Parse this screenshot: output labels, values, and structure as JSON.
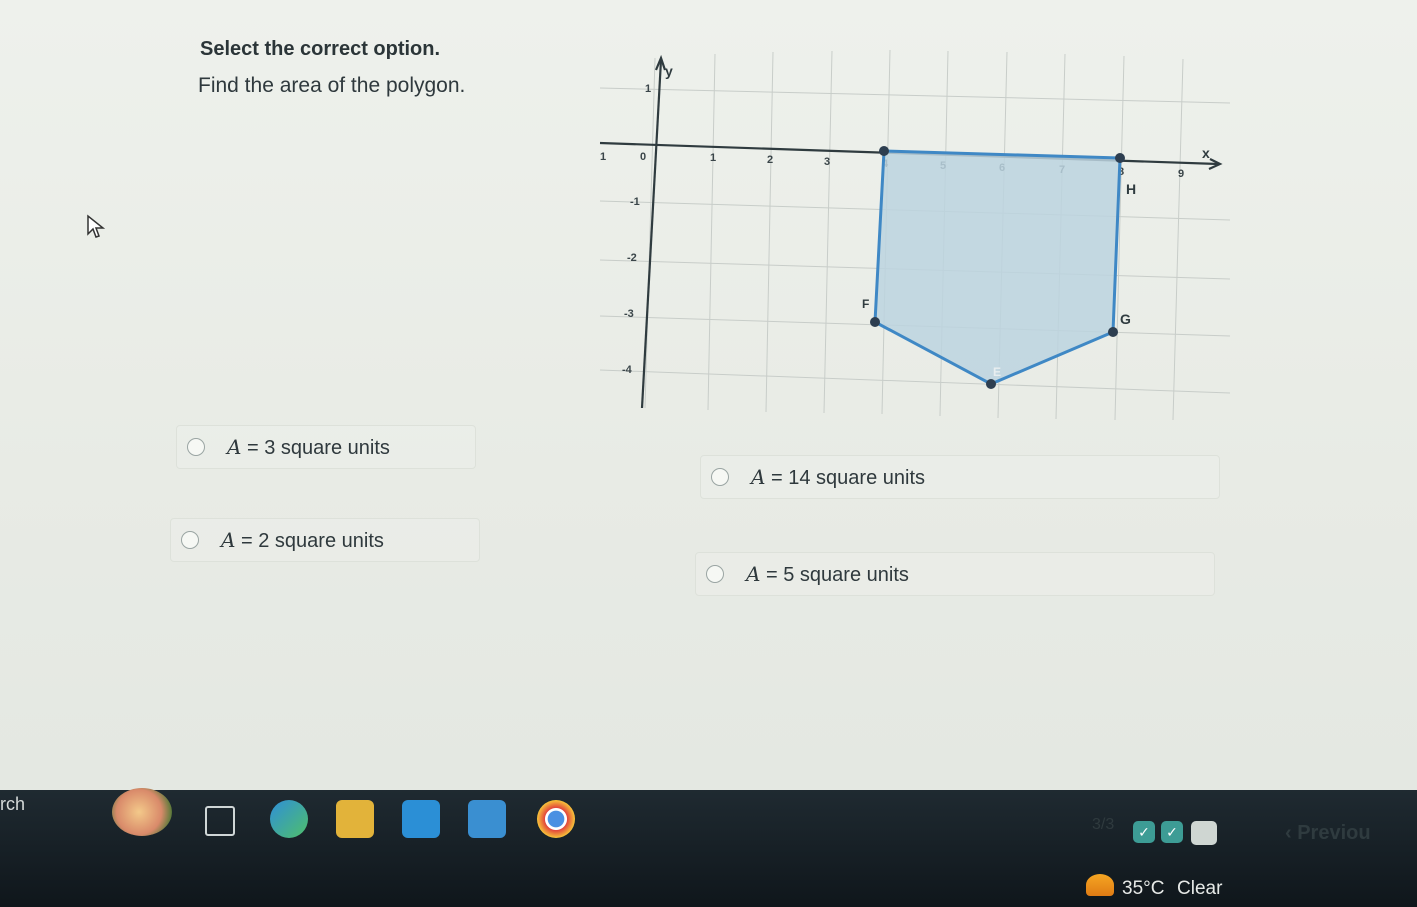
{
  "question": {
    "prompt": "Select the correct option.",
    "text": "Find the area of the polygon."
  },
  "graph": {
    "axis_x_label": "x",
    "axis_y_label": "y",
    "x_ticks": [
      "1",
      "0",
      "1",
      "2",
      "3",
      "4",
      "5",
      "6",
      "7",
      "8",
      "9"
    ],
    "y_ticks": [
      "1",
      "-1",
      "-2",
      "-3",
      "-4"
    ],
    "vertex_labels": [
      "H",
      "F",
      "G",
      "E"
    ],
    "fill_color": "#bcd3df",
    "stroke_color": "#3f88c5"
  },
  "options": [
    {
      "var": "A",
      "rest": "= 3 square units"
    },
    {
      "var": "A",
      "rest": "= 14 square units"
    },
    {
      "var": "A",
      "rest": "= 2 square units"
    },
    {
      "var": "A",
      "rest": "= 5 square units"
    }
  ],
  "progress": {
    "text": "3/3",
    "check_glyph": "✓",
    "accent": "#3d9c95"
  },
  "nav": {
    "previous_label": "‹ Previou"
  },
  "taskbar": {
    "search_text": "rch",
    "weather_temp": "35°C",
    "weather_desc": "Clear"
  }
}
